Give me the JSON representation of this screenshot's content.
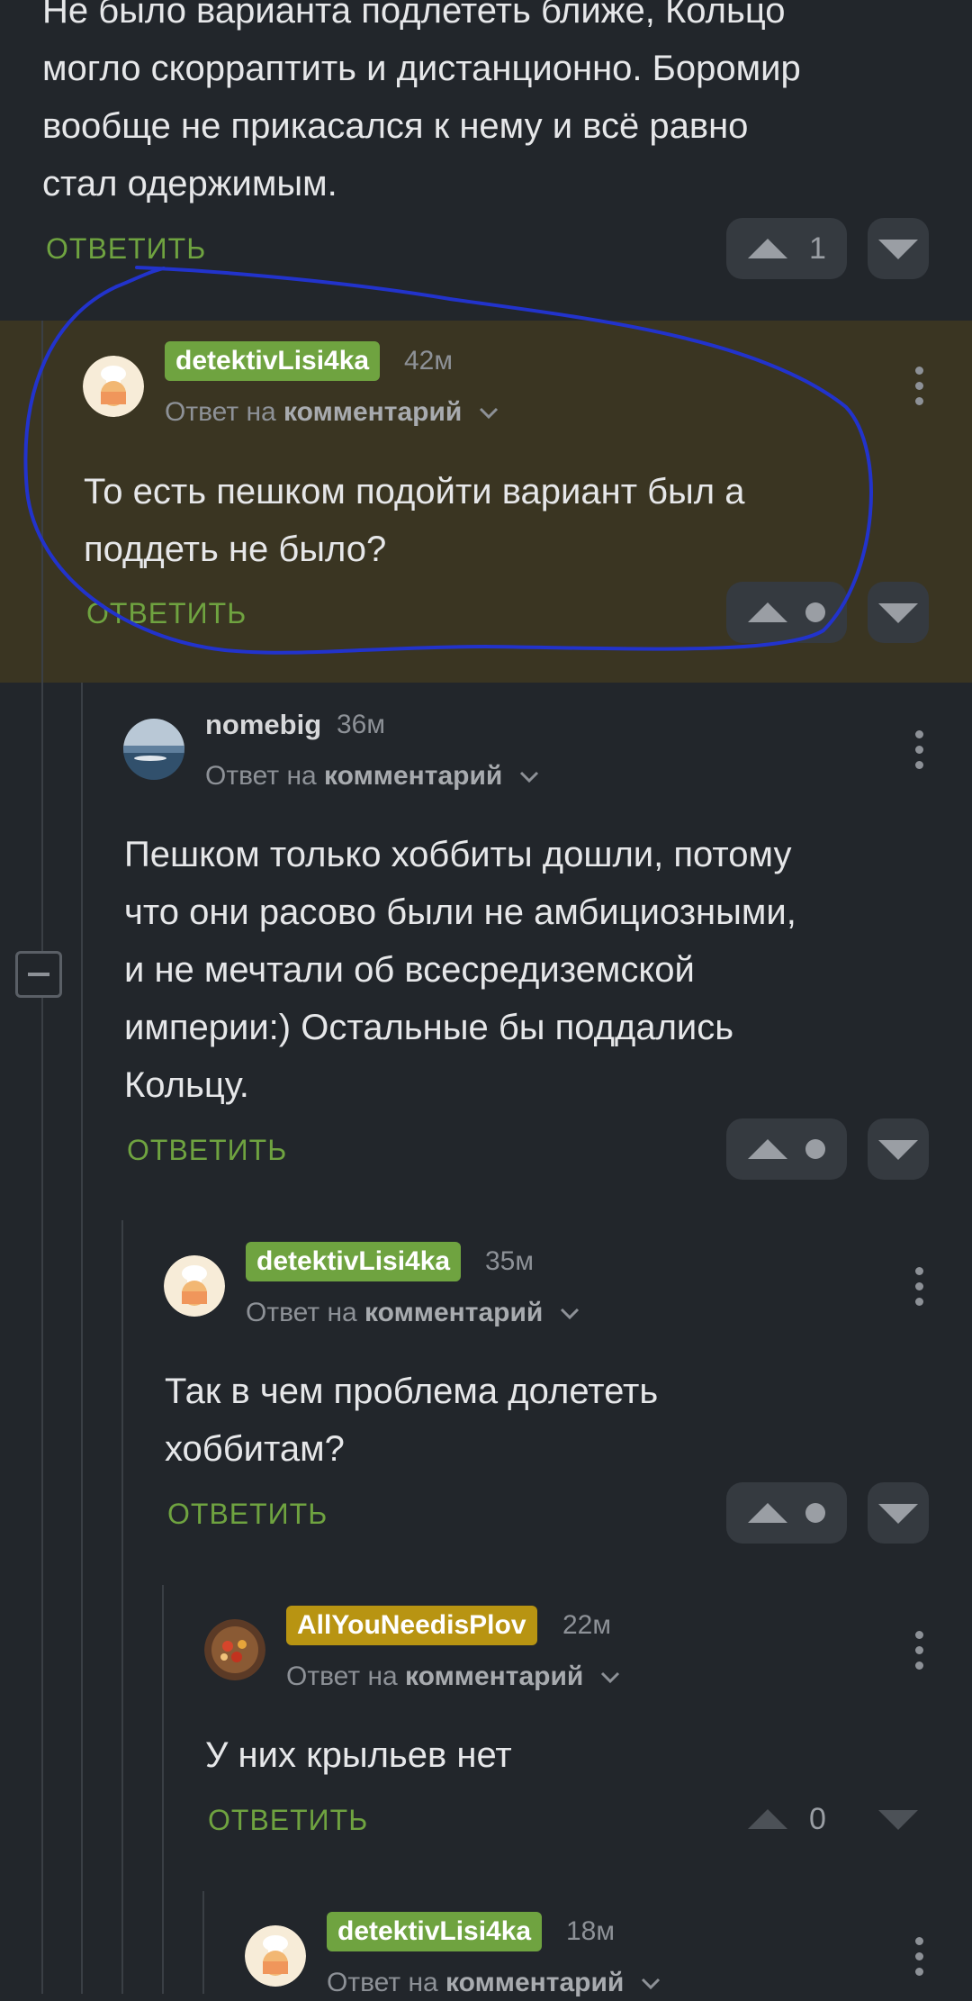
{
  "comments": [
    {
      "id": "c0",
      "body_lines": [
        "Не было варианта подлететь ближе, Кольцо",
        "могло скорраптить и дистанционно. Боромир",
        "вообще не прикасался к нему и всё равно",
        "стал одержимым."
      ],
      "reply_label": "ОТВЕТИТЬ",
      "votes": "1"
    },
    {
      "id": "c1",
      "author": "detektivLisi4ka",
      "author_badge_color": "#6fa340",
      "time": "42м",
      "reply_to_prefix": "Ответ на",
      "reply_to_target": "комментарий",
      "body_lines": [
        "То есть пешком подойти вариант был а",
        "поддеть не было?"
      ],
      "reply_label": "ОТВЕТИТЬ",
      "highlighted": true
    },
    {
      "id": "c2",
      "author": "nomebig",
      "time": "36м",
      "reply_to_prefix": "Ответ на",
      "reply_to_target": "комментарий",
      "body_lines": [
        "Пешком только хоббиты дошли, потому",
        "что они расово были не амбициозными,",
        "и не мечтали об всесредиземской",
        "империи:) Остальные бы поддались",
        "Кольцу."
      ],
      "reply_label": "ОТВЕТИТЬ"
    },
    {
      "id": "c3",
      "author": "detektivLisi4ka",
      "author_badge_color": "#6fa340",
      "time": "35м",
      "reply_to_prefix": "Ответ на",
      "reply_to_target": "комментарий",
      "body_lines": [
        "Так в чем проблема долететь",
        "хоббитам?"
      ],
      "reply_label": "ОТВЕТИТЬ"
    },
    {
      "id": "c4",
      "author": "AllYouNeedisPlov",
      "author_badge_color": "#b89412",
      "time": "22м",
      "reply_to_prefix": "Ответ на",
      "reply_to_target": "комментарий",
      "body_lines": [
        "У них крыльев нет"
      ],
      "reply_label": "ОТВЕТИТЬ",
      "votes": "0"
    },
    {
      "id": "c5",
      "author": "detektivLisi4ka",
      "author_badge_color": "#6fa340",
      "time": "18м",
      "reply_to_prefix": "Ответ на",
      "reply_to_target": "комментарий"
    }
  ],
  "annotation_color": "#2233cc",
  "accent_color": "#6fa340"
}
